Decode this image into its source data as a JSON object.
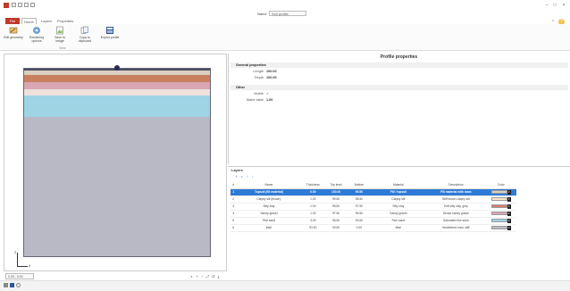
{
  "window": {
    "title_label": "Name",
    "title_value": "Soil profile",
    "controls": {
      "minimize": "–",
      "maximize": "□",
      "close": "×"
    }
  },
  "tabs": [
    {
      "label": "File"
    },
    {
      "label": "Home"
    },
    {
      "label": "Layers"
    },
    {
      "label": "Properties"
    }
  ],
  "ribbon": {
    "buttons": [
      {
        "label": "Edit geometry",
        "icon": "edit-geometry-icon"
      },
      {
        "label": "Rendering options",
        "icon": "rendering-icon"
      },
      {
        "label": "Save to image",
        "icon": "save-image-icon"
      },
      {
        "label": "Copy to clipboard",
        "icon": "copy-icon"
      },
      {
        "label": "Export profile",
        "icon": "export-icon"
      }
    ],
    "group_label": "View"
  },
  "canvas": {
    "axis_y": "Z",
    "axis_x": "X",
    "coord_value": "0.00 ; 0.00",
    "zoom_buttons": [
      "⌕",
      "+",
      "−",
      "⤢",
      "↺",
      "⤓"
    ],
    "layer_colors": [
      "#4b4d62",
      "#d9cfc3",
      "#c9805e",
      "#d9a7b4",
      "#efe1dc",
      "#9ed4e4",
      "#b9b9c6"
    ]
  },
  "properties": {
    "title": "Profile properties",
    "general_header": "General properties",
    "rows": [
      {
        "label": "Length",
        "value": "100.00"
      },
      {
        "label": "Depth",
        "value": "100.00"
      }
    ],
    "other_header": "Other",
    "other_rows": [
      {
        "label": "Visible",
        "value": "✓"
      },
      {
        "label": "Water table",
        "value": "1.00"
      }
    ]
  },
  "layers": {
    "title": "Layers",
    "toolbar": [
      "+",
      "×",
      "↑",
      "↓"
    ],
    "columns": [
      "#",
      "Name",
      "Thickness",
      "Top level",
      "Bottom",
      "Material",
      "Description",
      "Color"
    ],
    "rows": [
      {
        "no": "1",
        "name": "Topsoil (fill material)",
        "thickness": "0.50",
        "top": "100.00",
        "bottom": "99.50",
        "material": "Fill / topsoil",
        "description": "Fill material with loam",
        "color": "#d9cfc3",
        "selected": true
      },
      {
        "no": "2",
        "name": "Clayey silt (brown)",
        "thickness": "1.00",
        "top": "99.50",
        "bottom": "98.50",
        "material": "Clayey silt",
        "description": "Stiff brown clayey silt",
        "color": "#f6e7c8",
        "selected": false
      },
      {
        "no": "3",
        "name": "Silty clay",
        "thickness": "1.00",
        "top": "98.50",
        "bottom": "97.50",
        "material": "Silty clay",
        "description": "Soft silty clay, grey",
        "color": "#d97e6b",
        "selected": false
      },
      {
        "no": "4",
        "name": "Sandy gravel",
        "thickness": "1.00",
        "top": "97.50",
        "bottom": "96.50",
        "material": "Sandy gravel",
        "description": "Dense sandy gravel",
        "color": "#d9a7b4",
        "selected": false
      },
      {
        "no": "5",
        "name": "Fine sand",
        "thickness": "3.00",
        "top": "96.50",
        "bottom": "93.50",
        "material": "Fine sand",
        "description": "Saturated fine sand",
        "color": "#9ed4e4",
        "selected": false
      },
      {
        "no": "6",
        "name": "Marl",
        "thickness": "93.50",
        "top": "93.50",
        "bottom": "0.00",
        "material": "Marl",
        "description": "Weathered marl, stiff",
        "color": "#b9b9c6",
        "selected": false
      }
    ]
  },
  "status": {
    "icons": [
      "settings-icon",
      "save-icon",
      "info-icon"
    ]
  }
}
